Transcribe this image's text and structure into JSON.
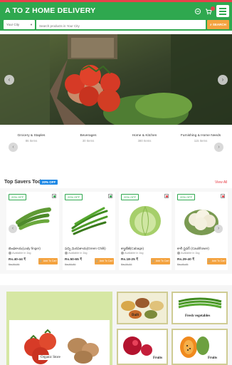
{
  "header": {
    "brand": "A TO Z HOME DELIVERY",
    "city_placeholder": "Your City",
    "search_placeholder": "Search products in Your City",
    "search_button": "SEARCH",
    "colors": {
      "primary": "#2fa84f",
      "accent": "#e8414a",
      "button": "#f4a340"
    },
    "icons": [
      "user-icon",
      "cart-icon",
      "menu-icon",
      "search-icon"
    ]
  },
  "banner": {
    "slide_count": 3,
    "active_slide": 1
  },
  "categories": [
    {
      "name": "Grocery & Staples",
      "count": "86 Items"
    },
    {
      "name": "Beverages",
      "count": "30 Items"
    },
    {
      "name": "Home & Kitchen",
      "count": "380 Items"
    },
    {
      "name": "Furnishing & Home Needs",
      "count": "115 Items"
    }
  ],
  "savers": {
    "title": "Top Savers Today",
    "badge": "20% OFF",
    "view_all": "View All",
    "products": [
      {
        "off": "20% OFF",
        "veg_color": "#2fa84f",
        "name": "బెండకాయ(Lady finger)",
        "avail": "Available in 1kg",
        "price": "Rs.40-44 ₹",
        "mrp": "Rs.50-55",
        "add": "Add To Cart"
      },
      {
        "off": "20% OFF",
        "veg_color": "#2fa84f",
        "name": "పచ్చి మిరపకాయ(Green Chilli)",
        "avail": "Available in 1kg",
        "price": "Rs.50-65 ₹",
        "mrp": "Rs.60-80",
        "add": "Add To Cart"
      },
      {
        "off": "20% OFF",
        "veg_color": "#e8414a",
        "name": "క్యాబేజీ(Cabage)",
        "avail": "Available in 1kg",
        "price": "Rs.18-25 ₹",
        "mrp": "Rs.20-32",
        "add": "Add To Cart"
      },
      {
        "off": "20% OFF",
        "veg_color": "#e8414a",
        "name": "కాలీ ఫ్లవర్ (Cauliflower)",
        "avail": "Available in 1kg",
        "price": "Rs.29-40 ₹",
        "mrp": "Rs.40-45",
        "add": "Add To Cart"
      }
    ]
  },
  "tiles": {
    "organic": "Organic Store",
    "dals": "DalS",
    "fresh_veg": "Fresh vegetables",
    "fruits1": "Fruits",
    "fruits2": "Fruits"
  }
}
